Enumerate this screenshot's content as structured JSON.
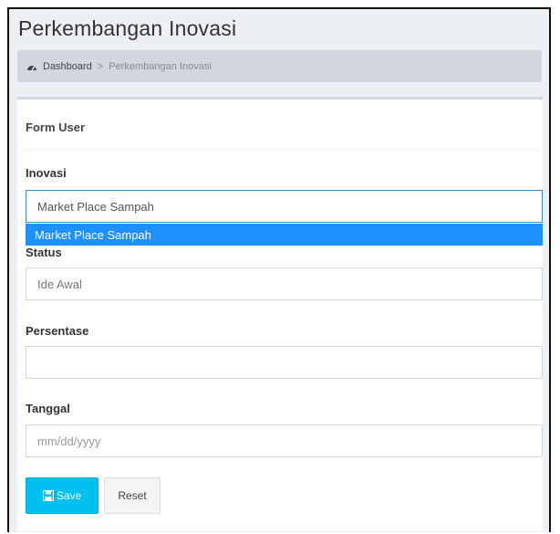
{
  "header": {
    "title": "Perkembangan Inovasi"
  },
  "breadcrumb": {
    "home": "Dashboard",
    "separator": ">",
    "current": "Perkembangan Inovasi",
    "home_icon": "dashboard-icon"
  },
  "form": {
    "title": "Form User",
    "inovasi": {
      "label": "Inovasi",
      "value": "Market Place Sampah",
      "options": [
        "Market Place Sampah"
      ],
      "highlighted_option": "Market Place Sampah"
    },
    "status": {
      "label": "Status",
      "value": "Ide Awal"
    },
    "persentase": {
      "label": "Persentase",
      "value": ""
    },
    "tanggal": {
      "label": "Tanggal",
      "placeholder": "mm/dd/yyyy"
    },
    "save_label": "Save",
    "save_icon": "save-icon",
    "reset_label": "Reset"
  },
  "colors": {
    "background": "#ecf0f5",
    "breadcrumb_bg": "#d2d6de",
    "save_button": "#00c0ef",
    "dropdown_highlight": "#1e90ff"
  }
}
